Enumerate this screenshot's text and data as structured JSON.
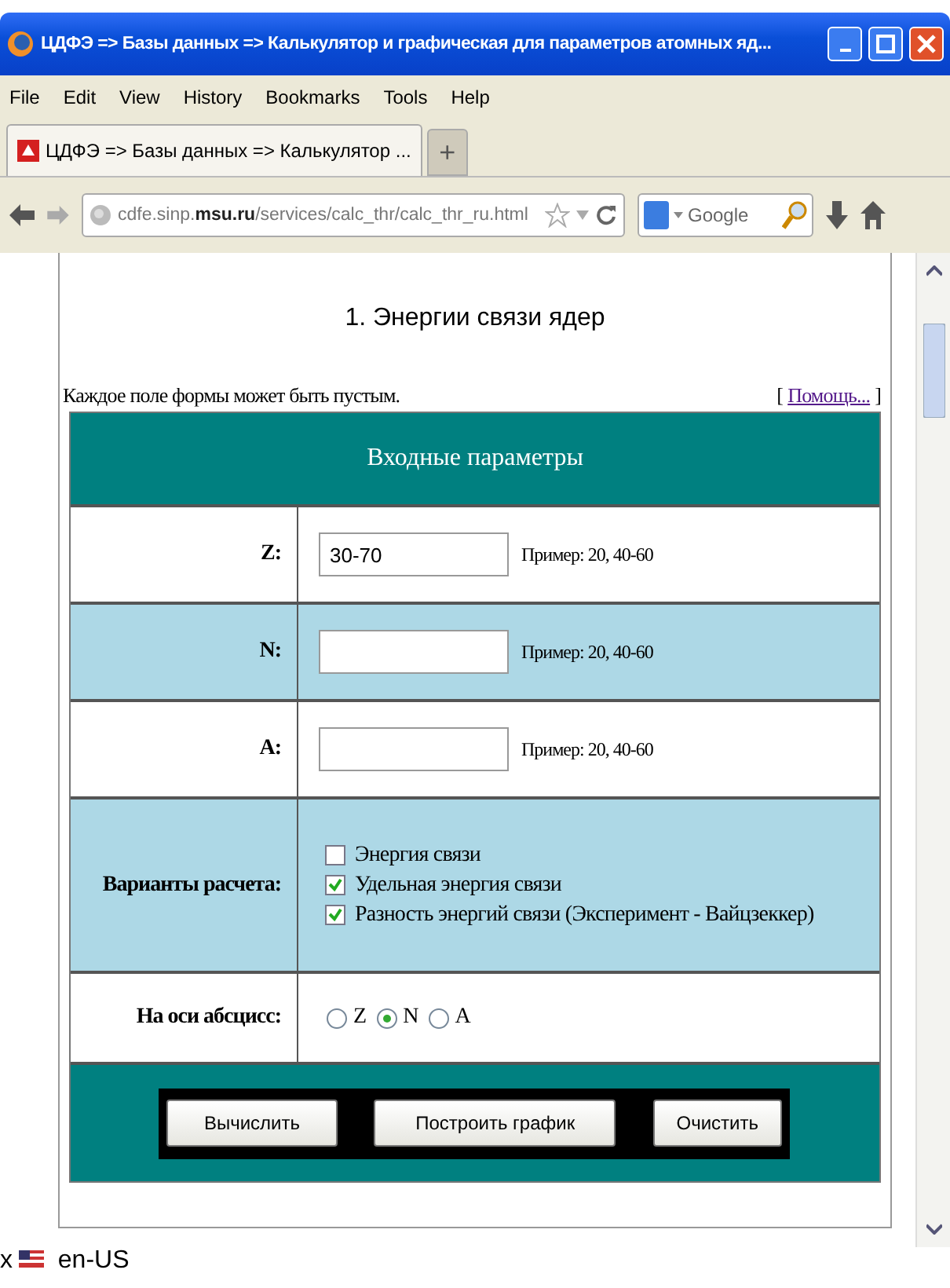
{
  "window": {
    "title": "ЦДФЭ => Базы данных => Калькулятор и графическая для параметров атомных яд..."
  },
  "menu": [
    "File",
    "Edit",
    "View",
    "History",
    "Bookmarks",
    "Tools",
    "Help"
  ],
  "tabs": [
    {
      "label": "ЦДФЭ => Базы данных => Калькулятор ...",
      "selected": true
    }
  ],
  "new_tab": "+",
  "address": "cdfe.sinp.**msu.ru**/services/calc_thr/calc_thr_ru.html",
  "search": {
    "placeholder": "Google"
  },
  "page": {
    "heading": "1. Энергии связи ядер",
    "note": "Каждое поле формы может быть пустым.",
    "help_open": "[",
    "help_link": "Помощь...",
    "help_close": "]",
    "table": {
      "title": "Входные параметры",
      "fields": [
        {
          "label": "Z:",
          "value": "30-70",
          "hint": "Пример: 20, 40-60"
        },
        {
          "label": "N:",
          "hint": "Пример: 20, 40-60"
        },
        {
          "label": "A:",
          "hint": "Пример: 20, 40-60"
        }
      ],
      "options": {
        "label": "Варианты расчета:",
        "items": [
          {
            "label": "Энергия связи",
            "checked": false
          },
          {
            "label": "Удельная энергия связи",
            "checked": true
          },
          {
            "label": "Разность энергий связи (Эксперимент - Вайцзеккер)",
            "checked": true
          }
        ]
      },
      "axis": {
        "label": "На оси абсцисс:",
        "choices": [
          {
            "label": "Z",
            "selected": false
          },
          {
            "label": "N",
            "selected": true
          },
          {
            "label": "A",
            "selected": false
          }
        ]
      },
      "buttons": [
        "Вычислить",
        "Построить график",
        "Очистить"
      ]
    }
  },
  "status_bar": {
    "close": "x",
    "locale": "en-US"
  }
}
